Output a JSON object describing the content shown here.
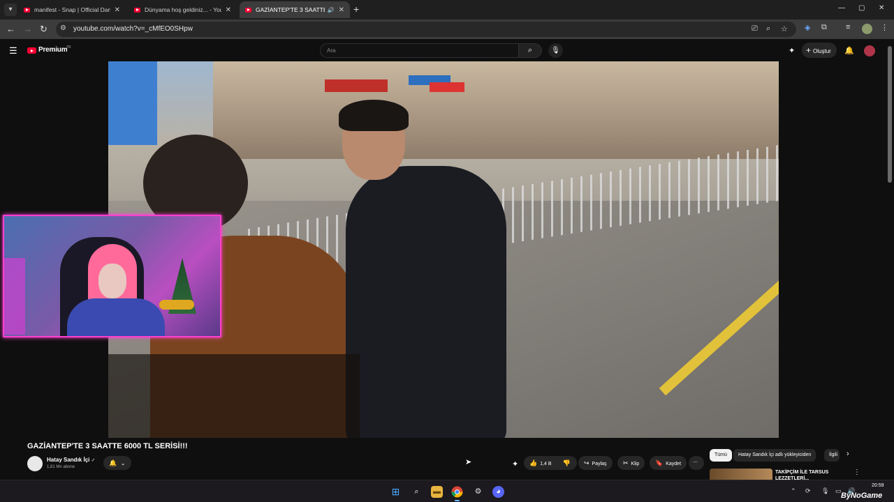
{
  "browser": {
    "tabs": [
      {
        "title": "manifest - Snap | Official Danc...",
        "active": false
      },
      {
        "title": "Dünyama hoş geldiniz... - YouT...",
        "active": false
      },
      {
        "title": "GAZİANTEP'TE 3 SAATTE 6...",
        "active": true
      }
    ],
    "close_glyph": "✕",
    "new_tab": "+",
    "url": "youtube.com/watch?v=_cMfEO0SHpw",
    "window_controls": {
      "minimize": "—",
      "maximize": "▢",
      "close": "✕"
    }
  },
  "youtube": {
    "brand": "Premium",
    "region": "TR",
    "search_placeholder": "Ara",
    "create_label": "Oluştur",
    "video": {
      "title": "GAZİANTEP'TE 3 SAATTE 6000 TL SERİSİ!!!",
      "channel": "Hatay Sandık İçi",
      "verified": "✓",
      "subscribers": "1,81 Mn abone",
      "likes": "1,4 B",
      "share_label": "Paylaş",
      "clip_label": "Klip",
      "save_label": "Kaydet"
    },
    "chips": [
      "Tümü",
      "Hatay Sandık İçi adlı yükleyiciden",
      "İlgili"
    ],
    "recommendation": {
      "title_line1": "TAKİPÇİM İLE TARSUS",
      "title_line2": "LEZZETLERİ..."
    }
  },
  "taskbar": {
    "time": "20:59",
    "date": "",
    "watermark": "ByNoGame"
  },
  "colors": {
    "youtube_red": "#ff0033",
    "cam_border": "#ff3fd0",
    "background": "#0f0f0f"
  }
}
